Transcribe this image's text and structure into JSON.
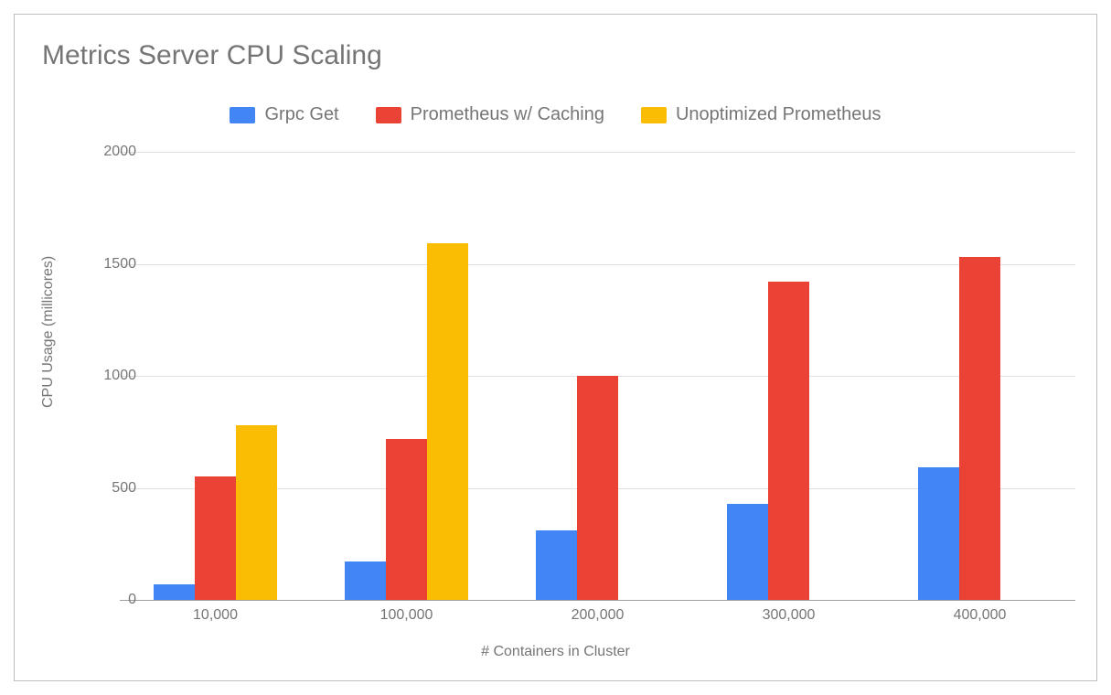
{
  "chart_data": {
    "type": "bar",
    "title": "Metrics Server CPU Scaling",
    "xlabel": "# Containers in Cluster",
    "ylabel": "CPU Usage (millicores)",
    "ylim": [
      0,
      2000
    ],
    "y_ticks": [
      0,
      500,
      1000,
      1500,
      2000
    ],
    "categories": [
      "10,000",
      "100,000",
      "200,000",
      "300,000",
      "400,000"
    ],
    "series": [
      {
        "name": "Grpc Get",
        "color": "#4285F4",
        "values": [
          70,
          170,
          310,
          430,
          590
        ]
      },
      {
        "name": "Prometheus w/ Caching",
        "color": "#EA4335",
        "values": [
          550,
          720,
          1000,
          1420,
          1530
        ]
      },
      {
        "name": "Unoptimized Prometheus",
        "color": "#FBBC04",
        "values": [
          780,
          1590,
          null,
          null,
          null
        ]
      }
    ],
    "legend_position": "top"
  }
}
